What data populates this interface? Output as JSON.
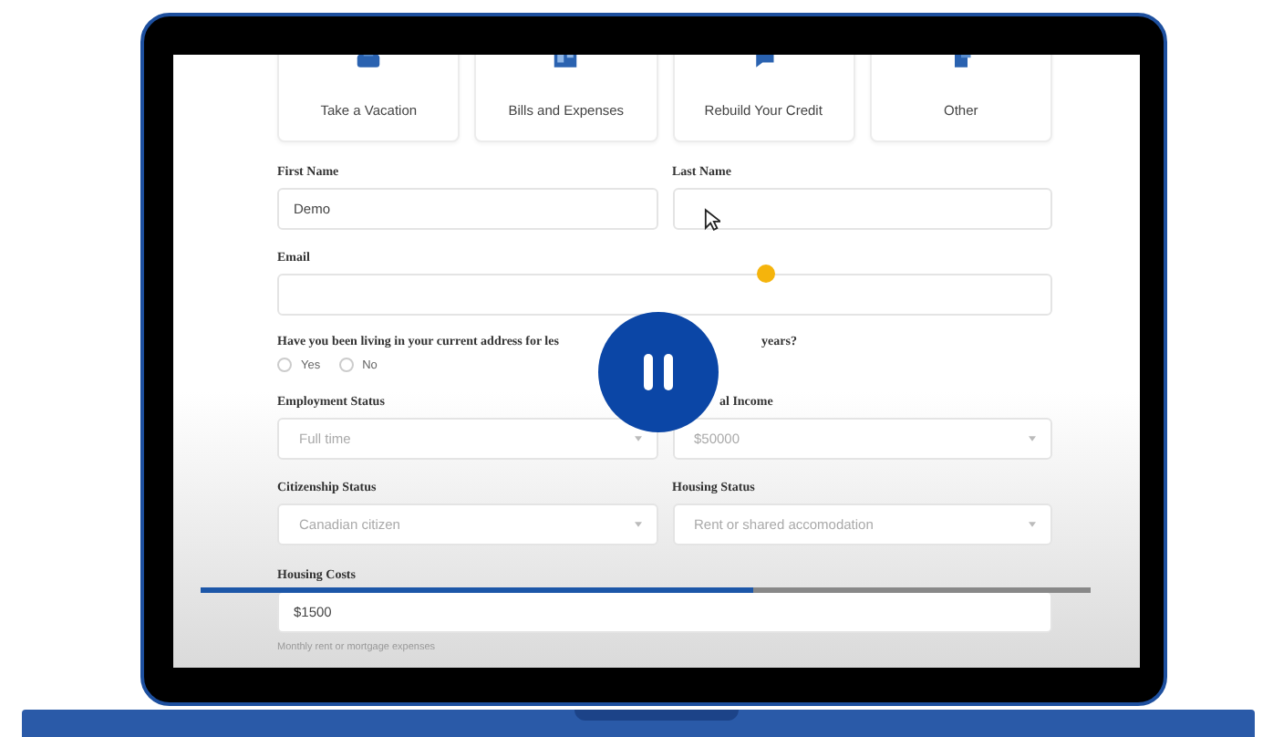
{
  "video": {
    "tiles": [
      {
        "label": "Take a Vacation"
      },
      {
        "label": "Bills and Expenses"
      },
      {
        "label": "Rebuild Your Credit"
      },
      {
        "label": "Other"
      }
    ],
    "rows": [
      [
        {
          "kind": "input",
          "label": "First Name",
          "value": "Demo"
        },
        {
          "kind": "input",
          "label": "Last Name"
        }
      ],
      [
        {
          "kind": "input",
          "label": "Email"
        }
      ],
      [
        {
          "kind": "question",
          "parts": [
            "Have you been living in your current address for les",
            "years?"
          ]
        }
      ],
      [
        {
          "kind": "radios",
          "options": [
            {
              "label": "Yes",
              "checked": false
            },
            {
              "label": "No",
              "checked": false
            }
          ]
        }
      ],
      [
        {
          "kind": "select",
          "label": "Employment Status",
          "value": "Full time"
        },
        {
          "kind": "select",
          "label": "al Income",
          "value": "$50000"
        }
      ],
      [
        {
          "kind": "select",
          "label": "Citizenship Status",
          "value": "Canadian citizen"
        },
        {
          "kind": "select",
          "label": "Housing Status",
          "value": "Rent or shared accomodation"
        }
      ],
      [
        {
          "kind": "input",
          "label": "Housing Costs",
          "value": "$1500",
          "helper": "Monthly rent or mortgage expenses"
        }
      ]
    ]
  },
  "player": {
    "level": 0.62
  }
}
